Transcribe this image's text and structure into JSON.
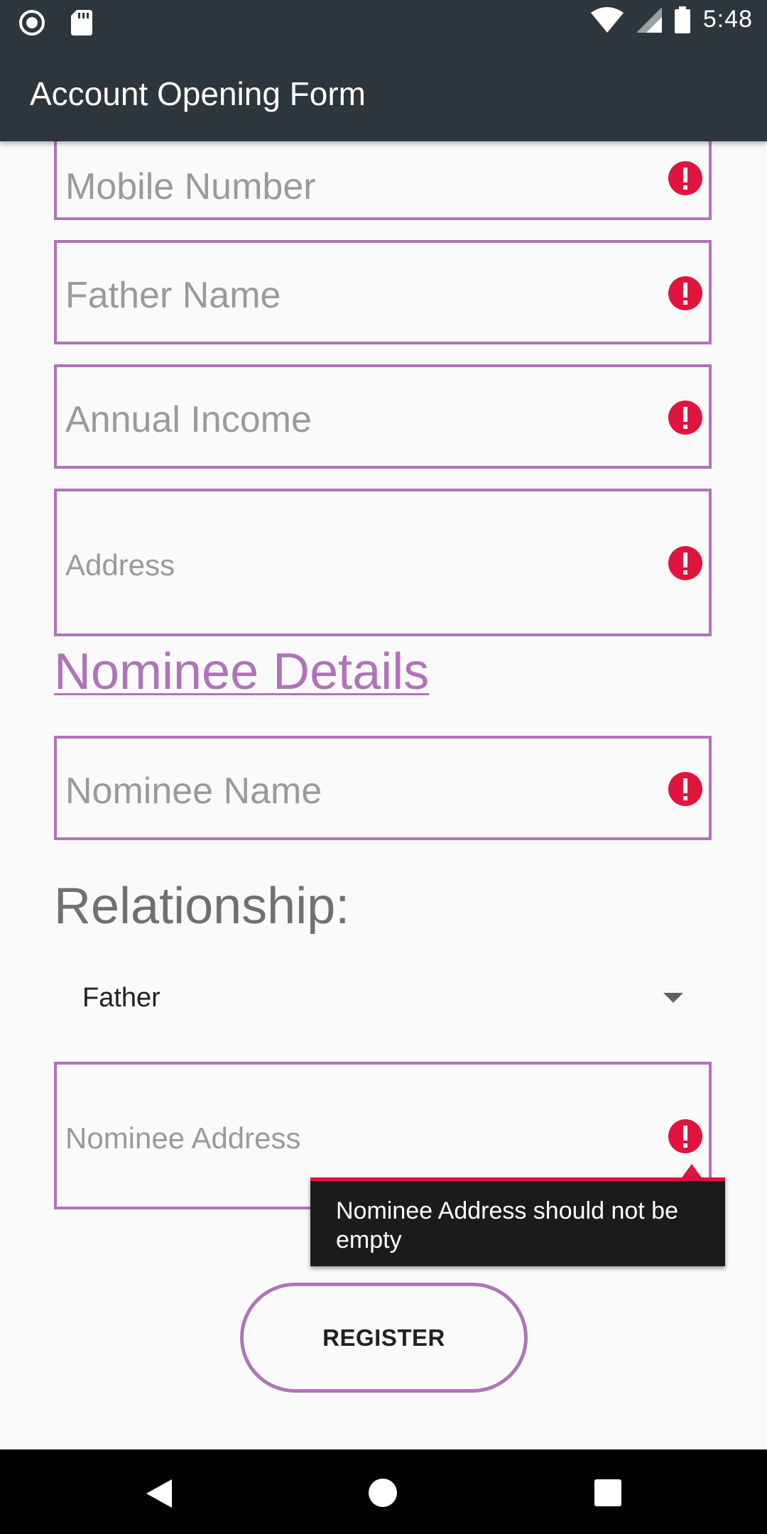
{
  "status_bar": {
    "time": "5:48",
    "icons": [
      "record-icon",
      "sd-card-icon",
      "wifi-icon",
      "signal-icon",
      "battery-icon"
    ]
  },
  "app_bar": {
    "title": "Account Opening Form"
  },
  "fields": {
    "mobile_number": {
      "placeholder": "Mobile Number"
    },
    "father_name": {
      "placeholder": "Father Name"
    },
    "annual_income": {
      "placeholder": "Annual Income"
    },
    "address": {
      "placeholder": "Address"
    },
    "nominee_name": {
      "placeholder": "Nominee Name"
    },
    "nominee_address": {
      "placeholder": "Nominee Address"
    }
  },
  "section": {
    "nominee_details": "Nominee Details"
  },
  "relationship": {
    "label": "Relationship:",
    "selected": "Father"
  },
  "error_tooltip": {
    "message": "Nominee Address should not be empty"
  },
  "register_button": {
    "label": "REGISTER"
  },
  "colors": {
    "accent": "#b073b9",
    "error": "#e0143d",
    "app_bar": "#2e363d",
    "tooltip_bg": "#1b1b1b"
  }
}
